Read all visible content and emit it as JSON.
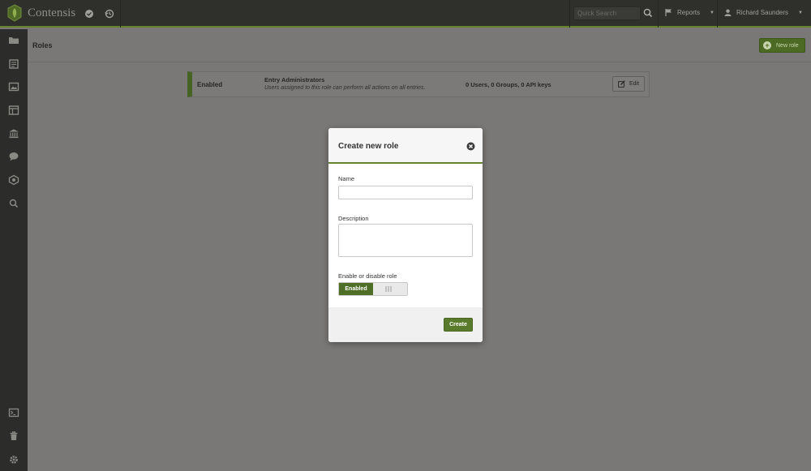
{
  "app": {
    "name": "Contensis"
  },
  "topbar": {
    "search_placeholder": "Quick Search",
    "reports_label": "Reports",
    "user_name": "Richard Saunders"
  },
  "page": {
    "title": "Roles",
    "new_role_label": "New role"
  },
  "roles": [
    {
      "status": "Enabled",
      "name": "Entry Administrators",
      "description": "Users assigned to this role can perform all actions on all entries.",
      "counts": "0 Users, 0 Groups, 0 API keys",
      "edit_label": "Edit"
    }
  ],
  "modal": {
    "title": "Create new role",
    "name_label": "Name",
    "name_value": "",
    "description_label": "Description",
    "description_value": "",
    "toggle_label": "Enable or disable role",
    "toggle_on_label": "Enabled",
    "create_label": "Create"
  },
  "colors": {
    "accent": "#66842e",
    "button_green": "#5a7b2c",
    "topbar": "#2f2f2c",
    "sidebar": "#2c2c2a",
    "overlay_bg": "#797876"
  },
  "icons": {
    "sidebar_top": [
      "folder-icon",
      "pages-icon",
      "image-icon",
      "layout-icon",
      "bank-icon",
      "comment-icon",
      "layers-icon",
      "search-icon"
    ],
    "sidebar_bottom": [
      "terminal-icon",
      "trash-icon",
      "gear-icon"
    ]
  }
}
